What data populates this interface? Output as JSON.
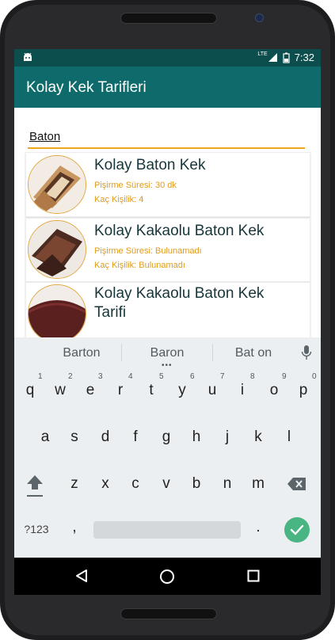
{
  "status_bar": {
    "time": "7:32",
    "network": "LTE"
  },
  "app_bar": {
    "title": "Kolay Kek Tarifleri"
  },
  "search": {
    "value": "Baton"
  },
  "recipes": [
    {
      "title": "Kolay Baton Kek",
      "time_line": "Pişirme Süresi: 30 dk",
      "servings_line": "Kaç Kişilik: 4"
    },
    {
      "title": "Kolay Kakaolu Baton Kek",
      "time_line": "Pişirme Süresi: Bulunamadı",
      "servings_line": "Kaç Kişilik: Bulunamadı"
    },
    {
      "title_line1": "Kolay Kakaolu Baton Kek",
      "title_line2": "Tarifi"
    }
  ],
  "keyboard": {
    "suggestions": [
      "Barton",
      "Baron",
      "Bat on"
    ],
    "row1": [
      "q",
      "w",
      "e",
      "r",
      "t",
      "y",
      "u",
      "i",
      "o",
      "p"
    ],
    "row1_hints": [
      "1",
      "2",
      "3",
      "4",
      "5",
      "6",
      "7",
      "8",
      "9",
      "0"
    ],
    "row2": [
      "a",
      "s",
      "d",
      "f",
      "g",
      "h",
      "j",
      "k",
      "l"
    ],
    "row3": [
      "z",
      "x",
      "c",
      "v",
      "b",
      "n",
      "m"
    ],
    "symbols_label": "?123",
    "comma": ",",
    "period": "."
  },
  "colors": {
    "status_bar": "#0c4d4d",
    "app_bar": "#0f6b6b",
    "accent": "#f0a61a",
    "meta_text": "#e09b1a",
    "enter_key": "#48b582"
  }
}
